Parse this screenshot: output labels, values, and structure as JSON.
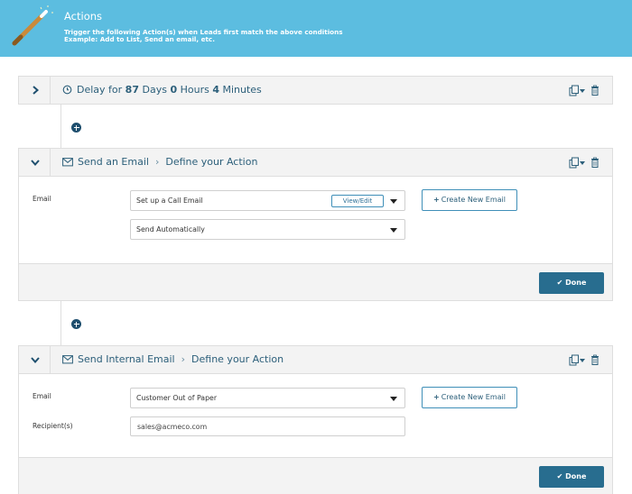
{
  "header": {
    "title": "Actions",
    "line1": "Trigger the following Action(s) when Leads first match the above conditions",
    "line2": "Example: Add to List, Send an email, etc."
  },
  "delay": {
    "prefix": "Delay for",
    "days": "87",
    "days_label": "Days",
    "hours": "0",
    "hours_label": "Hours",
    "minutes": "4",
    "minutes_label": "Minutes"
  },
  "send_email": {
    "title": "Send an Email",
    "crumb": "Define your Action",
    "email_label": "Email",
    "email_value": "Set up a Call Email",
    "view_edit": "View/Edit",
    "send_mode": "Send Automatically",
    "create_label": "Create New Email",
    "done_label": "Done"
  },
  "internal_email": {
    "title": "Send Internal Email",
    "crumb": "Define your Action",
    "email_label": "Email",
    "email_value": "Customer Out of Paper",
    "recipients_label": "Recipient(s)",
    "recipients_value": "sales@acmeco.com",
    "create_label": "Create New Email",
    "done_label": "Done"
  },
  "icons": [
    "magic-wand-icon",
    "chevron-right-icon",
    "chevron-down-icon",
    "clock-icon",
    "envelope-icon",
    "copy-icon",
    "trash-icon",
    "plus-circle-icon",
    "check-icon"
  ],
  "colors": {
    "header_bg": "#5cbde0",
    "primary": "#286d8f",
    "text_dark": "#2c5f7a"
  }
}
